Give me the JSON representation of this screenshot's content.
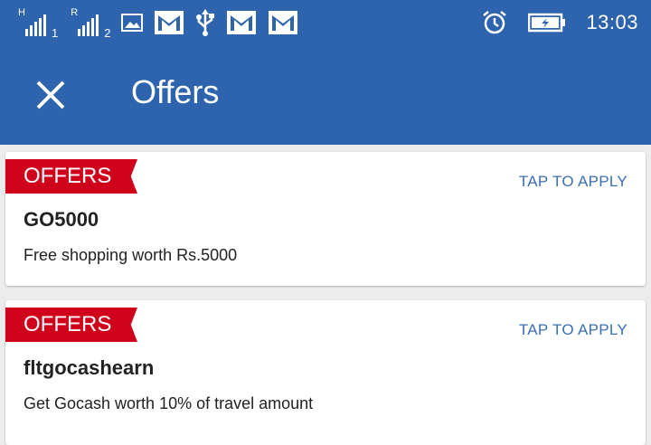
{
  "status_bar": {
    "sim1": {
      "network": "H",
      "sim_number": "1"
    },
    "sim2": {
      "network": "R",
      "sim_number": "2"
    },
    "icons": [
      "image-icon",
      "gmail-icon",
      "usb-icon",
      "gmail-icon",
      "gmail-icon",
      "alarm-icon",
      "battery-charging-icon"
    ],
    "time": "13:03"
  },
  "app_bar": {
    "title": "Offers",
    "close_icon": "close-icon"
  },
  "offers": [
    {
      "tag": "OFFERS",
      "action": "TAP TO APPLY",
      "code": "GO5000",
      "description": "Free shopping worth Rs.5000"
    },
    {
      "tag": "OFFERS",
      "action": "TAP TO APPLY",
      "code": "fltgocashearn",
      "description": "Get Gocash worth 10% of travel amount"
    }
  ],
  "colors": {
    "app_bar": "#2d64ad",
    "ribbon": "#d0021b",
    "action_text": "#3a6fb0",
    "background": "#ececec"
  }
}
